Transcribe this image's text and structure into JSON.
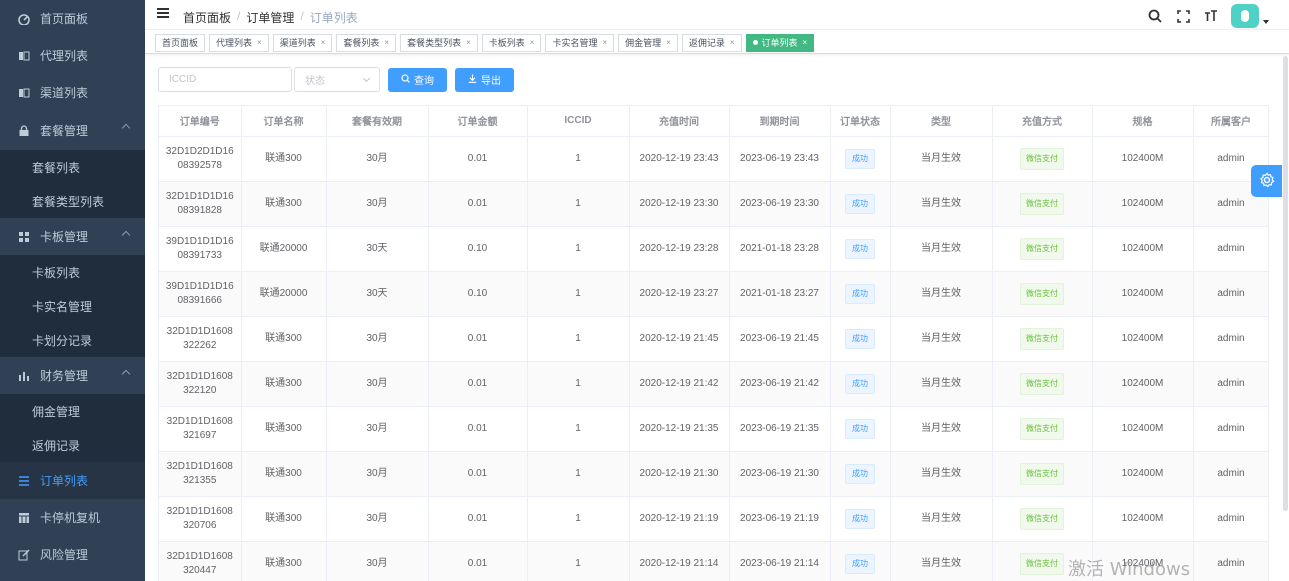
{
  "sidebar": {
    "items": [
      {
        "label": "首页面板",
        "icon": "dashboard-icon"
      },
      {
        "label": "代理列表",
        "icon": "agent-icon"
      },
      {
        "label": "渠道列表",
        "icon": "channel-icon"
      },
      {
        "label": "套餐管理",
        "icon": "lock-icon",
        "children": [
          "套餐列表",
          "套餐类型列表"
        ]
      },
      {
        "label": "卡板管理",
        "icon": "grid-icon",
        "children": [
          "卡板列表",
          "卡实名管理",
          "卡划分记录"
        ]
      },
      {
        "label": "财务管理",
        "icon": "chart-bar-icon",
        "children": [
          "佣金管理",
          "返佣记录"
        ]
      },
      {
        "label": "订单列表",
        "icon": "list-icon"
      },
      {
        "label": "卡停机复机",
        "icon": "table-icon"
      },
      {
        "label": "风险管理",
        "icon": "edit-icon"
      }
    ]
  },
  "header": {
    "breadcrumb": [
      "首页面板",
      "订单管理",
      "订单列表"
    ]
  },
  "tags": [
    {
      "label": "首页面板",
      "closable": false
    },
    {
      "label": "代理列表",
      "closable": true
    },
    {
      "label": "渠道列表",
      "closable": true
    },
    {
      "label": "套餐列表",
      "closable": true
    },
    {
      "label": "套餐类型列表",
      "closable": true
    },
    {
      "label": "卡板列表",
      "closable": true
    },
    {
      "label": "卡实名管理",
      "closable": true
    },
    {
      "label": "佣金管理",
      "closable": true
    },
    {
      "label": "返佣记录",
      "closable": true
    },
    {
      "label": "订单列表",
      "closable": true,
      "active": true
    }
  ],
  "filter": {
    "iccid_placeholder": "ICCID",
    "status_placeholder": "状态",
    "search_label": "查询",
    "export_label": "导出"
  },
  "table": {
    "columns": [
      "订单编号",
      "订单名称",
      "套餐有效期",
      "订单金额",
      "ICCID",
      "充值时间",
      "到期时间",
      "订单状态",
      "类型",
      "充值方式",
      "规格",
      "所属客户"
    ],
    "rows": [
      [
        "32D1D2D1D16\n08392578",
        "联通300",
        "30月",
        "0.01",
        "1",
        "2020-12-19 23:43",
        "2023-06-19 23:43",
        "成功",
        "当月生效",
        "微信支付",
        "102400M",
        "admin"
      ],
      [
        "32D1D1D1D16\n08391828",
        "联通300",
        "30月",
        "0.01",
        "1",
        "2020-12-19 23:30",
        "2023-06-19 23:30",
        "成功",
        "当月生效",
        "微信支付",
        "102400M",
        "admin"
      ],
      [
        "39D1D1D1D16\n08391733",
        "联通20000",
        "30天",
        "0.10",
        "1",
        "2020-12-19 23:28",
        "2021-01-18 23:28",
        "成功",
        "当月生效",
        "微信支付",
        "102400M",
        "admin"
      ],
      [
        "39D1D1D1D16\n08391666",
        "联通20000",
        "30天",
        "0.10",
        "1",
        "2020-12-19 23:27",
        "2021-01-18 23:27",
        "成功",
        "当月生效",
        "微信支付",
        "102400M",
        "admin"
      ],
      [
        "32D1D1D1608\n322262",
        "联通300",
        "30月",
        "0.01",
        "1",
        "2020-12-19 21:45",
        "2023-06-19 21:45",
        "成功",
        "当月生效",
        "微信支付",
        "102400M",
        "admin"
      ],
      [
        "32D1D1D1608\n322120",
        "联通300",
        "30月",
        "0.01",
        "1",
        "2020-12-19 21:42",
        "2023-06-19 21:42",
        "成功",
        "当月生效",
        "微信支付",
        "102400M",
        "admin"
      ],
      [
        "32D1D1D1608\n321697",
        "联通300",
        "30月",
        "0.01",
        "1",
        "2020-12-19 21:35",
        "2023-06-19 21:35",
        "成功",
        "当月生效",
        "微信支付",
        "102400M",
        "admin"
      ],
      [
        "32D1D1D1608\n321355",
        "联通300",
        "30月",
        "0.01",
        "1",
        "2020-12-19 21:30",
        "2023-06-19 21:30",
        "成功",
        "当月生效",
        "微信支付",
        "102400M",
        "admin"
      ],
      [
        "32D1D1D1608\n320706",
        "联通300",
        "30月",
        "0.01",
        "1",
        "2020-12-19 21:19",
        "2023-06-19 21:19",
        "成功",
        "当月生效",
        "微信支付",
        "102400M",
        "admin"
      ],
      [
        "32D1D1D1608\n320447",
        "联通300",
        "30月",
        "0.01",
        "1",
        "2020-12-19 21:14",
        "2023-06-19 21:14",
        "成功",
        "当月生效",
        "微信支付",
        "102400M",
        "admin"
      ]
    ]
  },
  "watermark": "激活 Windows",
  "colors": {
    "sidebar_bg": "#304156",
    "primary": "#409eff",
    "tag_active": "#42b983"
  }
}
